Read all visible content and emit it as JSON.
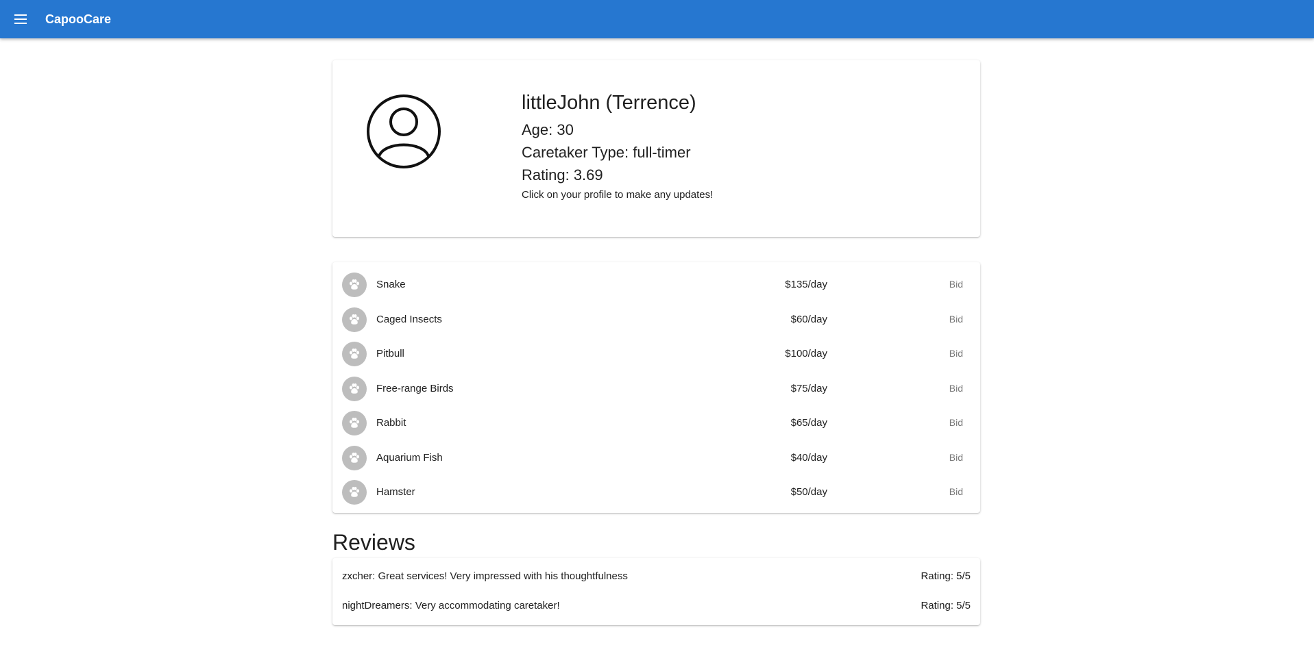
{
  "app": {
    "title": "CapooCare",
    "menu_icon": "hamburger-menu-icon",
    "accent_color": "#2677d0"
  },
  "profile": {
    "name": "littleJohn (Terrence)",
    "age": "Age: 30",
    "caretaker_type": "Caretaker Type: full-timer",
    "rating": "Rating: 3.69",
    "hint": "Click on your profile to make any updates!",
    "avatar_icon": "account-circle-icon"
  },
  "services": [
    {
      "name": "Snake",
      "price": "$135/day",
      "action": "Bid",
      "icon": "paw-icon"
    },
    {
      "name": "Caged Insects",
      "price": "$60/day",
      "action": "Bid",
      "icon": "paw-icon"
    },
    {
      "name": "Pitbull",
      "price": "$100/day",
      "action": "Bid",
      "icon": "paw-icon"
    },
    {
      "name": "Free-range Birds",
      "price": "$75/day",
      "action": "Bid",
      "icon": "paw-icon"
    },
    {
      "name": "Rabbit",
      "price": "$65/day",
      "action": "Bid",
      "icon": "paw-icon"
    },
    {
      "name": "Aquarium Fish",
      "price": "$40/day",
      "action": "Bid",
      "icon": "paw-icon"
    },
    {
      "name": "Hamster",
      "price": "$50/day",
      "action": "Bid",
      "icon": "paw-icon"
    }
  ],
  "reviews": {
    "title": "Reviews",
    "items": [
      {
        "text": "zxcher: Great services! Very impressed with his thoughtfulness",
        "rating": "Rating: 5/5"
      },
      {
        "text": "nightDreamers: Very accommodating caretaker!",
        "rating": "Rating: 5/5"
      }
    ]
  }
}
